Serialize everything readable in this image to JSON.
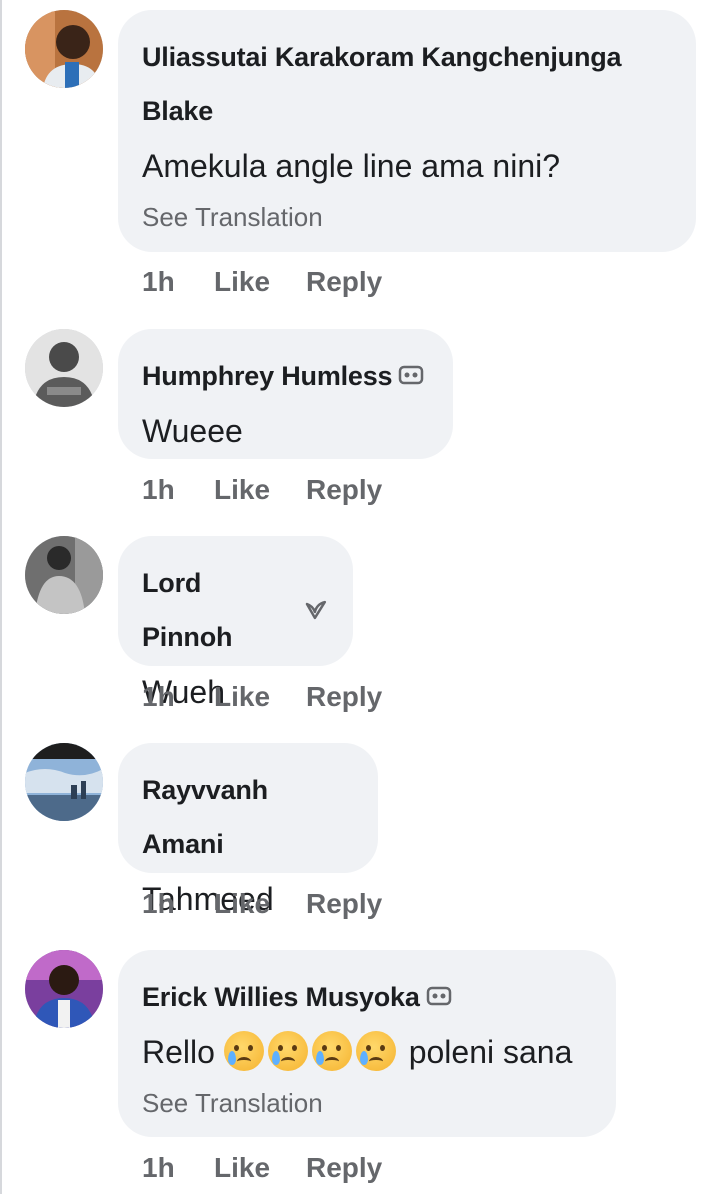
{
  "comments": [
    {
      "name_line1": "Uliassutai Karakoram Kangchenjunga",
      "name_line2": "Blake",
      "text": "Amekula angle line ama nini?",
      "translation": "See Translation",
      "time": "1h",
      "like": "Like",
      "reply": "Reply",
      "avatar": "profile-photo-man-dark-shirt"
    },
    {
      "name": "Humphrey Humless",
      "badge_icon": "top-fan-badge-icon",
      "text": "Wueee",
      "time": "1h",
      "like": "Like",
      "reply": "Reply",
      "avatar": "profile-photo-man-gray"
    },
    {
      "name": "Lord Pinnoh",
      "badge_icon": "rising-fan-badge-icon",
      "text": "Wueh",
      "time": "1h",
      "like": "Like",
      "reply": "Reply",
      "avatar": "profile-photo-man-jacket"
    },
    {
      "name": "Rayvvanh Amani",
      "text": "Tahmeed",
      "time": "1h",
      "like": "Like",
      "reply": "Reply",
      "avatar": "profile-photo-sky-skyline"
    },
    {
      "name": "Erick Willies Musyoka",
      "badge_icon": "top-fan-badge-icon",
      "text_prefix": "Rello",
      "emojis": [
        "crying-face-emoji",
        "crying-face-emoji",
        "crying-face-emoji",
        "crying-face-emoji"
      ],
      "text_suffix": "poleni sana",
      "translation": "See Translation",
      "time": "1h",
      "like": "Like",
      "reply": "Reply",
      "avatar": "profile-photo-man-blue-shirt"
    }
  ]
}
